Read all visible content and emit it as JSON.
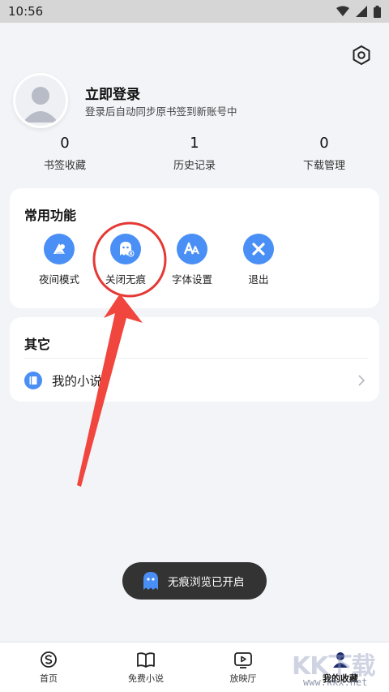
{
  "status_bar": {
    "time": "10:56"
  },
  "profile": {
    "title": "立即登录",
    "subtitle": "登录后自动同步原书签到新账号中"
  },
  "stats": [
    {
      "count": "0",
      "label": "书签收藏"
    },
    {
      "count": "1",
      "label": "历史记录"
    },
    {
      "count": "0",
      "label": "下载管理"
    }
  ],
  "common": {
    "title": "常用功能",
    "items": [
      {
        "label": "夜间模式",
        "icon": "night-mode-icon"
      },
      {
        "label": "关闭无痕",
        "icon": "incognito-ghost-icon"
      },
      {
        "label": "字体设置",
        "icon": "font-settings-icon"
      },
      {
        "label": "退出",
        "icon": "close-x-icon"
      }
    ]
  },
  "other": {
    "title": "其它",
    "items": [
      {
        "label": "我的小说",
        "icon": "book-icon"
      }
    ]
  },
  "toast": {
    "text": "无痕浏览已开启",
    "icon": "ghost-icon"
  },
  "bottom_nav": {
    "items": [
      {
        "label": "首页",
        "icon": "home-s-icon"
      },
      {
        "label": "免费小说",
        "icon": "open-book-icon"
      },
      {
        "label": "放映厅",
        "icon": "play-icon"
      },
      {
        "label": "我的收藏",
        "icon": "user-icon",
        "active": true
      }
    ]
  },
  "watermark": {
    "brand": "KK下载",
    "site": "www.kkx.net"
  },
  "colors": {
    "accent": "#4a8ff5",
    "annotation": "#e53935",
    "toast_bg": "#333333"
  }
}
